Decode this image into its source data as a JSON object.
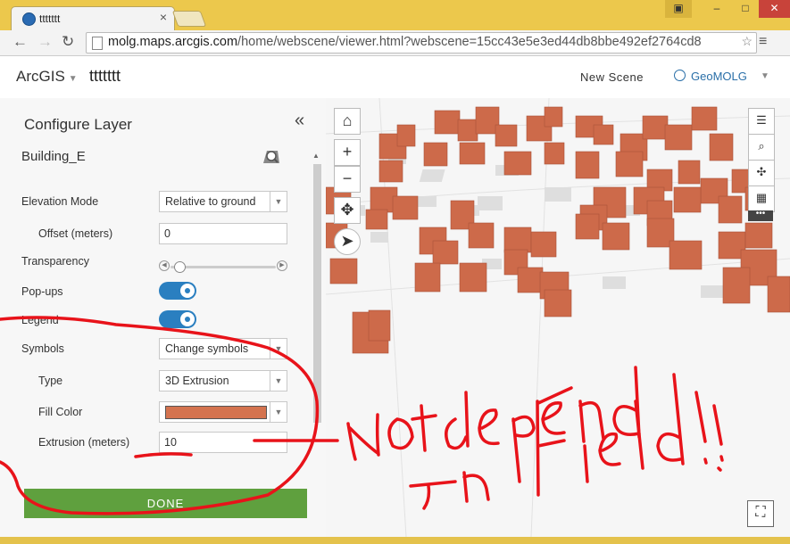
{
  "browser": {
    "tab_title": "ttttttt",
    "url_host": "molg.maps.arcgis.com",
    "url_path": "/home/webscene/viewer.html?webscene=15cc43e5e3ed44db8bbe492ef2764cd8",
    "icons": [
      "back-icon",
      "forward-icon",
      "reload-icon",
      "page-icon",
      "bookmark-star-icon",
      "menu-icon"
    ]
  },
  "header": {
    "brand": "ArcGIS",
    "scene_title": "ttttttt",
    "new_scene": "New Scene",
    "user": "GeoMOLG"
  },
  "panel": {
    "title": "Configure Layer",
    "layer_name": "Building_E",
    "rows": {
      "elevation_mode": {
        "label": "Elevation Mode",
        "value": "Relative to ground"
      },
      "offset": {
        "label": "Offset (meters)",
        "value": "0"
      },
      "transparency": {
        "label": "Transparency",
        "level": 0.05
      },
      "popups": {
        "label": "Pop-ups",
        "on": true
      },
      "legend": {
        "label": "Legend",
        "on": true
      },
      "symbols": {
        "label": "Symbols",
        "value": "Change symbols"
      },
      "type": {
        "label": "Type",
        "value": "3D Extrusion"
      },
      "fill_color": {
        "label": "Fill Color",
        "color": "#d4734f"
      },
      "extrusion": {
        "label": "Extrusion (meters)",
        "value": "10"
      }
    },
    "done": "DONE"
  },
  "annotation": {
    "text_line1": "Not depend",
    "text_line2": "on Field!!",
    "color": "#e8131a"
  },
  "colors": {
    "building": "#cd6a4a",
    "accent": "#2a7fc0",
    "done": "#5fa03e"
  }
}
